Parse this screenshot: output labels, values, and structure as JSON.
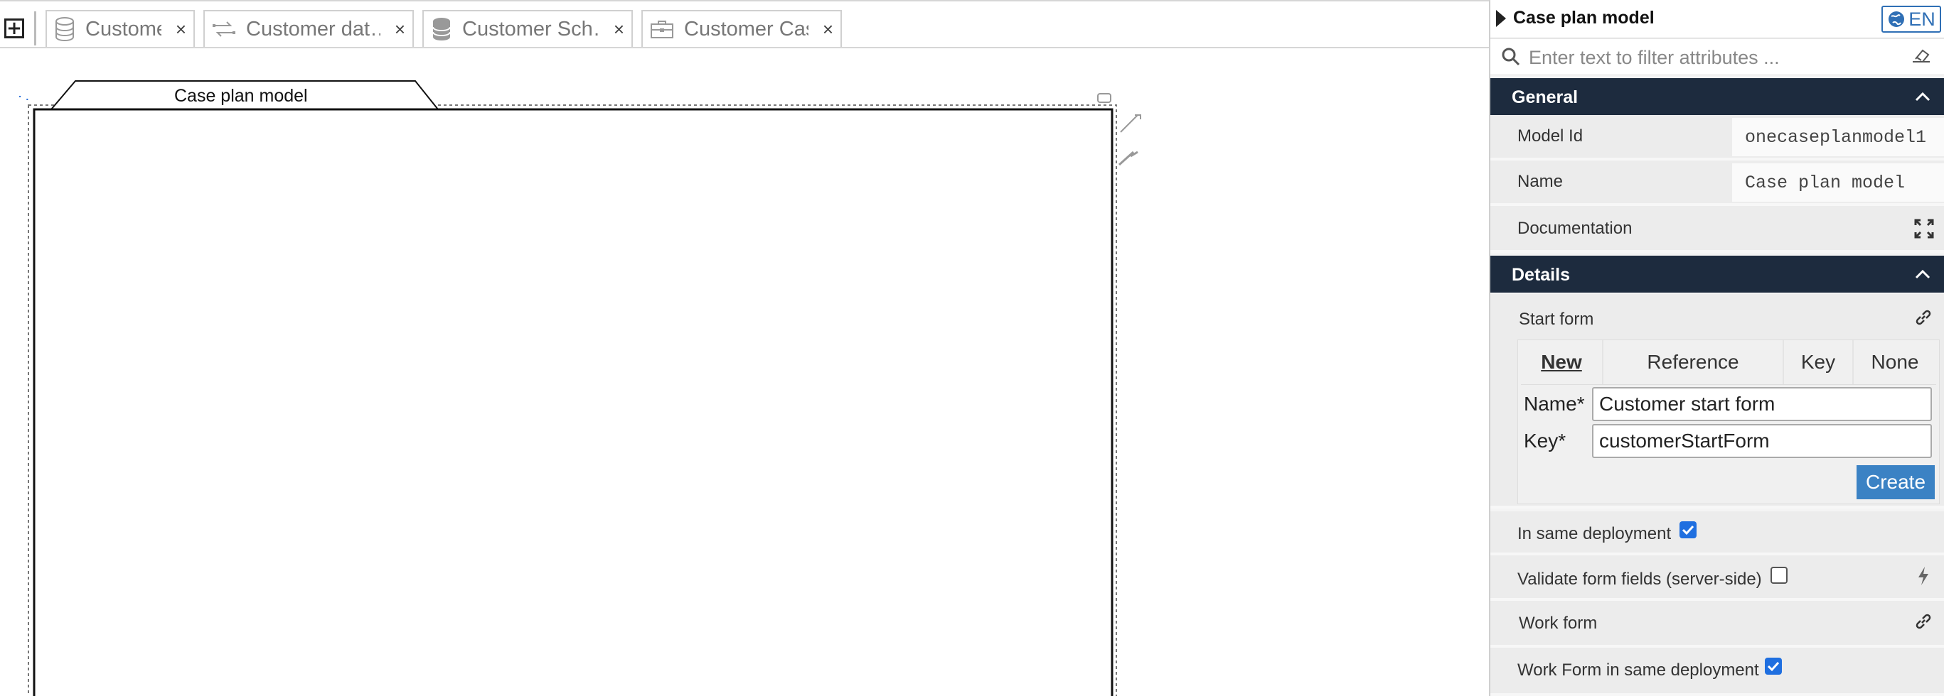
{
  "tabs": {
    "add_label": "+",
    "items": [
      {
        "label": "Customer",
        "icon": "database-icon"
      },
      {
        "label": "Customer dat…",
        "icon": "data-object-icon"
      },
      {
        "label": "Customer Sch…",
        "icon": "database-icon"
      },
      {
        "label": "Customer Case",
        "icon": "briefcase-icon"
      }
    ],
    "close_label": "×"
  },
  "canvas": {
    "plan_model_label": "Case plan model"
  },
  "panel": {
    "title": "Case plan model",
    "language": "EN",
    "filter_placeholder": "Enter text to filter attributes ...",
    "general": {
      "label": "General",
      "model_id_label": "Model Id",
      "model_id_value": "onecaseplanmodel1",
      "name_label": "Name",
      "name_value": "Case plan model",
      "documentation_label": "Documentation"
    },
    "details": {
      "label": "Details",
      "start_form_label": "Start form",
      "form_tabs": [
        "New",
        "Reference",
        "Key",
        "None"
      ],
      "name_field_label": "Name*",
      "name_field_value": "Customer start form",
      "key_field_label": "Key*",
      "key_field_value": "customerStartForm",
      "create_label": "Create",
      "same_deployment_label": "In same deployment",
      "same_deployment_checked": true,
      "validate_label": "Validate form fields (server-side)",
      "validate_checked": false,
      "work_form_label": "Work form",
      "work_form_same_deployment_label": "Work Form in same deployment",
      "work_form_same_deployment_checked": true
    }
  },
  "colors": {
    "section_header": "#1d2b3e",
    "accent": "#3b82c4",
    "checkbox": "#1f6fe0"
  }
}
